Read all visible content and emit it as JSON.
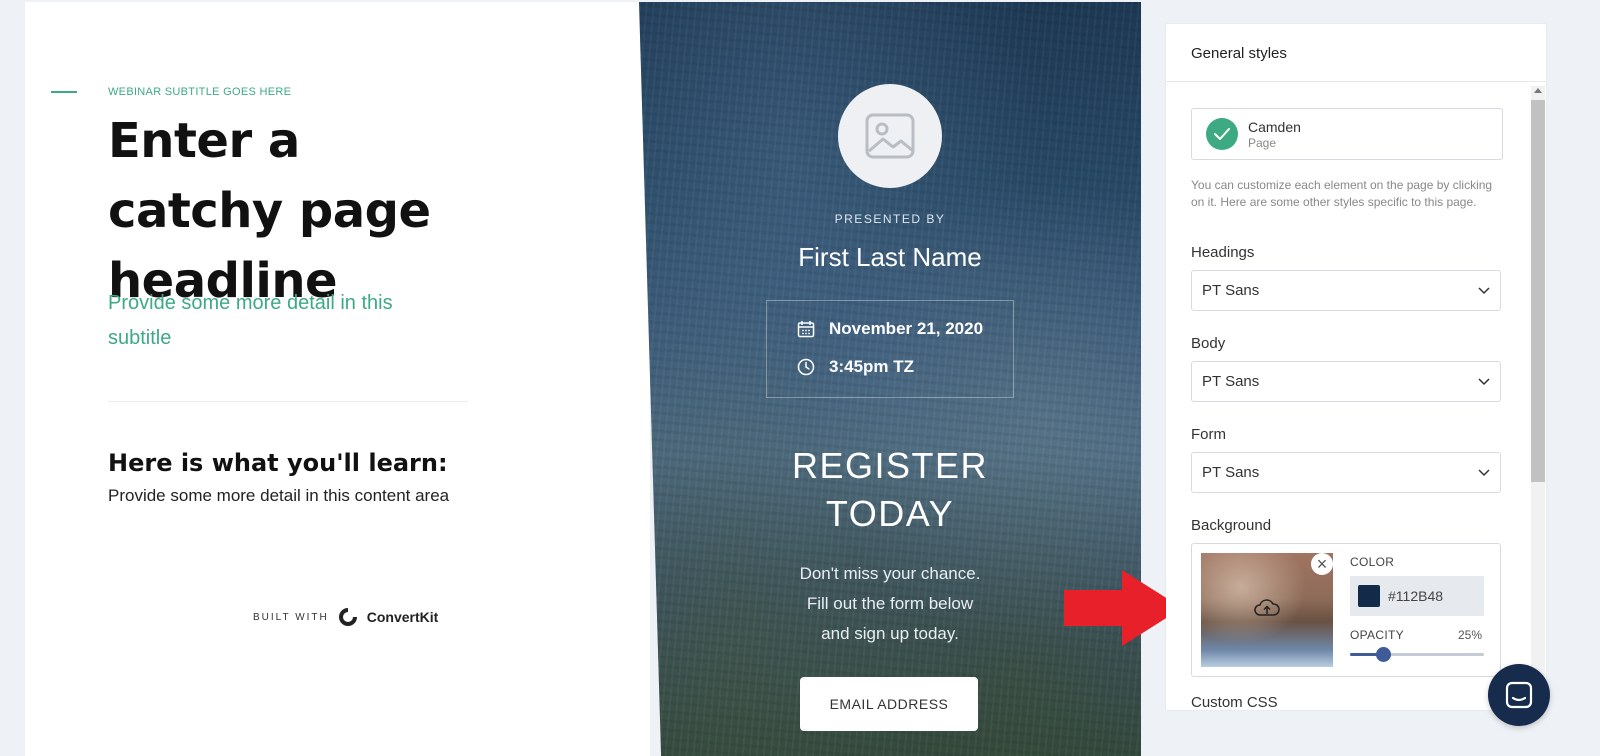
{
  "landing": {
    "webinar_subtitle": "WEBINAR SUBTITLE GOES HERE",
    "headline": "Enter a catchy page headline",
    "subtitle": "Provide some more detail in this subtitle",
    "learn_title": "Here is what you'll learn:",
    "learn_body": "Provide some more detail in this content area",
    "built_with_label": "BUILT WITH",
    "brand_name": "ConvertKit"
  },
  "hero": {
    "presented_by": "PRESENTED BY",
    "speaker_name": "First Last Name",
    "date": "November 21, 2020",
    "time": "3:45pm TZ",
    "register_line1": "REGISTER",
    "register_line2": "TODAY",
    "cta_line1": "Don't miss your chance.",
    "cta_line2": "Fill out the form below",
    "cta_line3": "and sign up today.",
    "email_placeholder": "EMAIL ADDRESS"
  },
  "panel": {
    "title": "General styles",
    "theme_name": "Camden",
    "theme_type": "Page",
    "help_text": "You can customize each element on the page by clicking on it. Here are some other styles specific to this page.",
    "headings_label": "Headings",
    "headings_value": "PT Sans",
    "body_label": "Body",
    "body_value": "PT Sans",
    "form_label": "Form",
    "form_value": "PT Sans",
    "background_label": "Background",
    "color_label": "COLOR",
    "color_value": "#112B48",
    "opacity_label": "OPACITY",
    "opacity_value": "25%",
    "opacity_fraction": 0.25,
    "custom_css_label": "Custom CSS"
  },
  "colors": {
    "accent_green": "#3daa84",
    "background_color": "#112b48",
    "slider_blue": "#3f5b98",
    "chat_navy": "#172b4d",
    "arrow_red": "#e8202a"
  },
  "icons": [
    "image-placeholder-icon",
    "calendar-icon",
    "clock-icon",
    "check-icon",
    "chevron-down-icon",
    "close-icon",
    "upload-cloud-icon",
    "chat-icon",
    "convertkit-logo-icon"
  ]
}
